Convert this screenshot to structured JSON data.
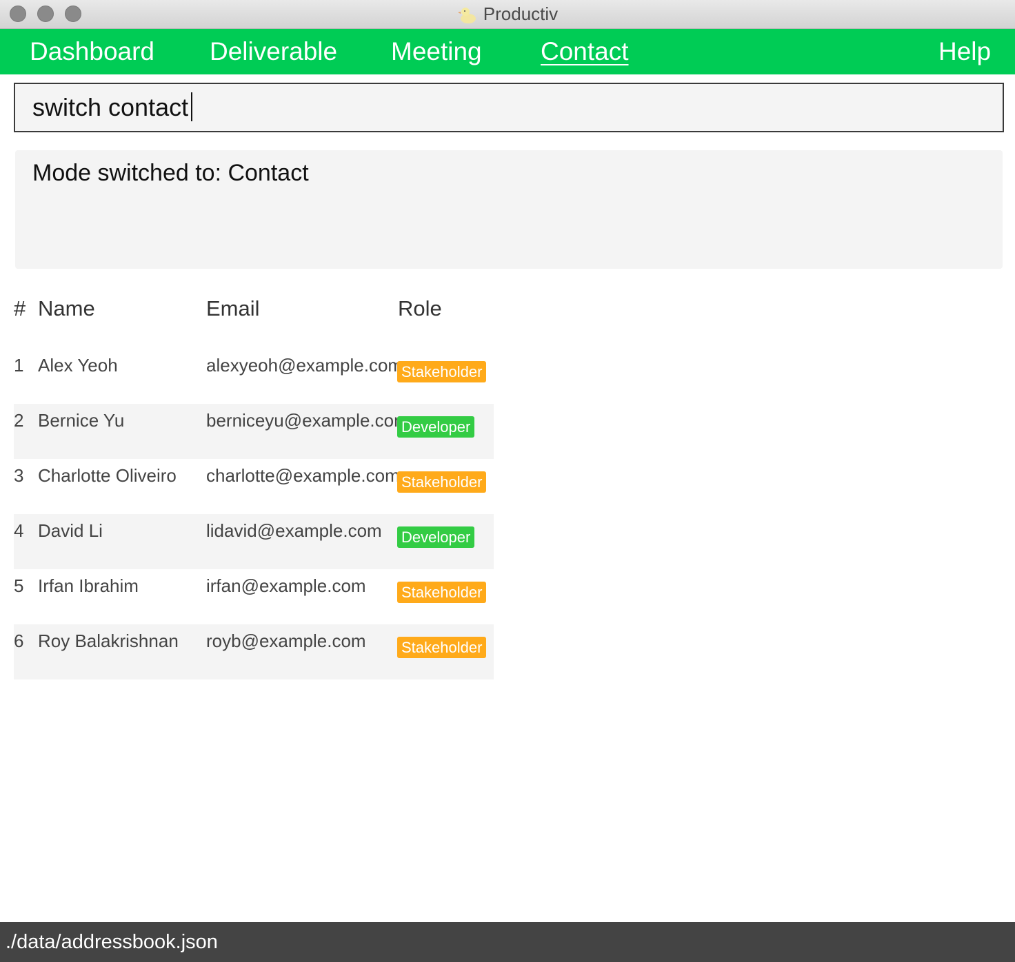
{
  "window": {
    "title": "Productiv"
  },
  "nav": {
    "items": [
      {
        "label": "Dashboard",
        "active": false
      },
      {
        "label": "Deliverable",
        "active": false
      },
      {
        "label": "Meeting",
        "active": false
      },
      {
        "label": "Contact",
        "active": true
      }
    ],
    "help_label": "Help"
  },
  "command": {
    "value": "switch contact"
  },
  "result": {
    "message": "Mode switched to: Contact"
  },
  "table": {
    "columns": {
      "index": "#",
      "name": "Name",
      "email": "Email",
      "role": "Role"
    },
    "rows": [
      {
        "index": "1",
        "name": "Alex Yeoh",
        "email": "alexyeoh@example.com",
        "role": "Stakeholder"
      },
      {
        "index": "2",
        "name": "Bernice Yu",
        "email": "berniceyu@example.com",
        "role": "Developer"
      },
      {
        "index": "3",
        "name": "Charlotte Oliveiro",
        "email": "charlotte@example.com",
        "role": "Stakeholder"
      },
      {
        "index": "4",
        "name": "David Li",
        "email": "lidavid@example.com",
        "role": "Developer"
      },
      {
        "index": "5",
        "name": "Irfan Ibrahim",
        "email": "irfan@example.com",
        "role": "Stakeholder"
      },
      {
        "index": "6",
        "name": "Roy Balakrishnan",
        "email": "royb@example.com",
        "role": "Stakeholder"
      }
    ]
  },
  "status": {
    "path": "./data/addressbook.json"
  },
  "colors": {
    "nav_bg": "#00cc55",
    "stakeholder": "#ffaa1a",
    "developer": "#33cc44",
    "status_bg": "#444444"
  },
  "icons": {
    "app": "duck-icon"
  }
}
